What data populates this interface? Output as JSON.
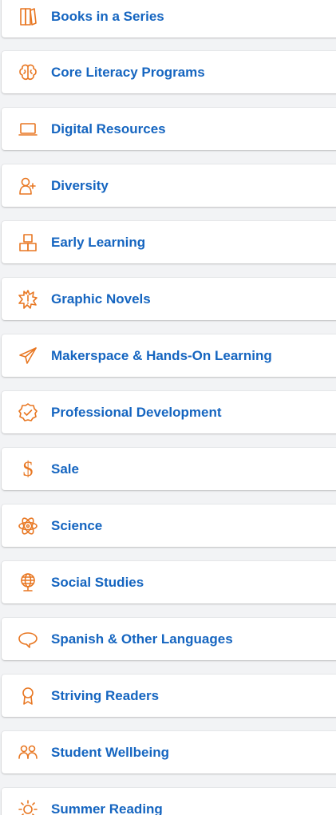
{
  "colors": {
    "accent": "#e87722",
    "link": "#1565c0",
    "card": "#ffffff"
  },
  "items": [
    {
      "label": "Books in a Series",
      "icon": "books-icon"
    },
    {
      "label": "Core Literacy Programs",
      "icon": "brain-icon"
    },
    {
      "label": "Digital Resources",
      "icon": "laptop-icon"
    },
    {
      "label": "Diversity",
      "icon": "person-add-icon"
    },
    {
      "label": "Early Learning",
      "icon": "blocks-icon"
    },
    {
      "label": "Graphic Novels",
      "icon": "exclamation-burst-icon"
    },
    {
      "label": "Makerspace & Hands-On Learning",
      "icon": "paper-plane-icon"
    },
    {
      "label": "Professional Development",
      "icon": "badge-check-icon"
    },
    {
      "label": "Sale",
      "icon": "dollar-icon",
      "glyph": "$"
    },
    {
      "label": "Science",
      "icon": "atom-icon"
    },
    {
      "label": "Social Studies",
      "icon": "globe-icon"
    },
    {
      "label": "Spanish & Other Languages",
      "icon": "speech-bubble-icon"
    },
    {
      "label": "Striving Readers",
      "icon": "ribbon-icon"
    },
    {
      "label": "Student Wellbeing",
      "icon": "people-icon"
    },
    {
      "label": "Summer Reading",
      "icon": "sun-icon"
    }
  ]
}
